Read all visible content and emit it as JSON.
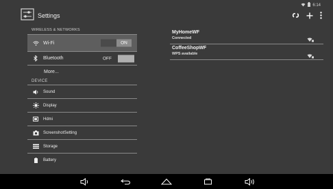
{
  "header": {
    "title": "Settings",
    "time": "6:14"
  },
  "left": {
    "section_wireless": "WIRELESS & NETWORKS",
    "wifi": {
      "label": "Wi-Fi",
      "toggle": "ON"
    },
    "bluetooth": {
      "label": "Bluetooth",
      "toggle": "OFF"
    },
    "more": "More...",
    "section_device": "DEVICE",
    "device_items": [
      "Sound",
      "Display",
      "Hdmi",
      "ScreenshotSetting",
      "Storage",
      "Battery"
    ]
  },
  "networks": [
    {
      "name": "MyHomeWF",
      "status": "Connected"
    },
    {
      "name": "CoffeeShopWF",
      "status": "WPS available"
    }
  ],
  "colors": {
    "background": "#3a3a3a",
    "selected_row": "#5e5e5e",
    "navbar": "#000000"
  },
  "icons": {
    "logo": "settings-logo-icon",
    "status": [
      "wifi-status-icon",
      "battery-icon"
    ],
    "actions": [
      "wps-icon",
      "add-icon",
      "overflow-menu-icon"
    ],
    "nav": [
      "volume-down-icon",
      "back-icon",
      "home-icon",
      "recents-icon",
      "volume-up-icon"
    ]
  }
}
